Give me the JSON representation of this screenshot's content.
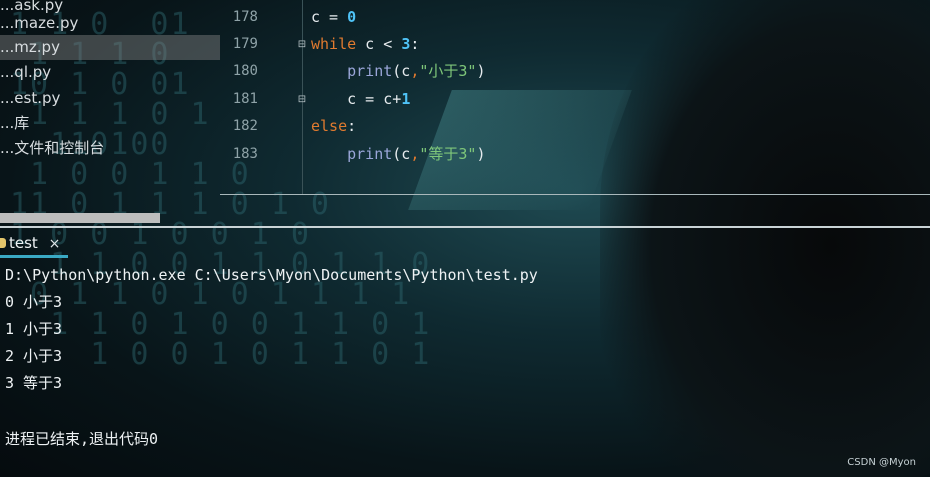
{
  "project_tree": {
    "items": [
      {
        "label": "...ask.py"
      },
      {
        "label": "...maze.py"
      },
      {
        "label": "...mz.py",
        "selected": true
      },
      {
        "label": "...ql.py"
      },
      {
        "label": "...est.py"
      },
      {
        "label": "...库"
      },
      {
        "label": "...文件和控制台"
      }
    ]
  },
  "editor": {
    "lines": [
      {
        "number": "178"
      },
      {
        "number": "179"
      },
      {
        "number": "180"
      },
      {
        "number": "181"
      },
      {
        "number": "182"
      },
      {
        "number": "183"
      }
    ],
    "code": {
      "l178": {
        "a": "c = ",
        "b": "0"
      },
      "l179": {
        "a": "while",
        "b": " c < ",
        "c": "3",
        "d": ":"
      },
      "l180": {
        "a": "    ",
        "b": "print",
        "c": "(c",
        "d": ",",
        "e": "\"小于3\"",
        "f": ")"
      },
      "l181": {
        "a": "    c = c+",
        "b": "1"
      },
      "l182": {
        "a": "else",
        "b": ":"
      },
      "l183": {
        "a": "    ",
        "b": "print",
        "c": "(c",
        "d": ",",
        "e": "\"等于3\"",
        "f": ")"
      }
    }
  },
  "run_panel": {
    "tab_label": "test",
    "close_glyph": "×",
    "console_lines": [
      "D:\\Python\\python.exe C:\\Users\\Myon\\Documents\\Python\\test.py",
      "0 小于3",
      "1 小于3",
      "2 小于3",
      "3 等于3",
      "",
      "进程已结束,退出代码0"
    ]
  },
  "watermark": "CSDN @Myon⁠",
  "colors": {
    "keyword": "#e07a2f",
    "number": "#4fc3f7",
    "string": "#7fc77a",
    "function": "#9aa6d9",
    "tab_underline": "#3aa9c4"
  }
}
